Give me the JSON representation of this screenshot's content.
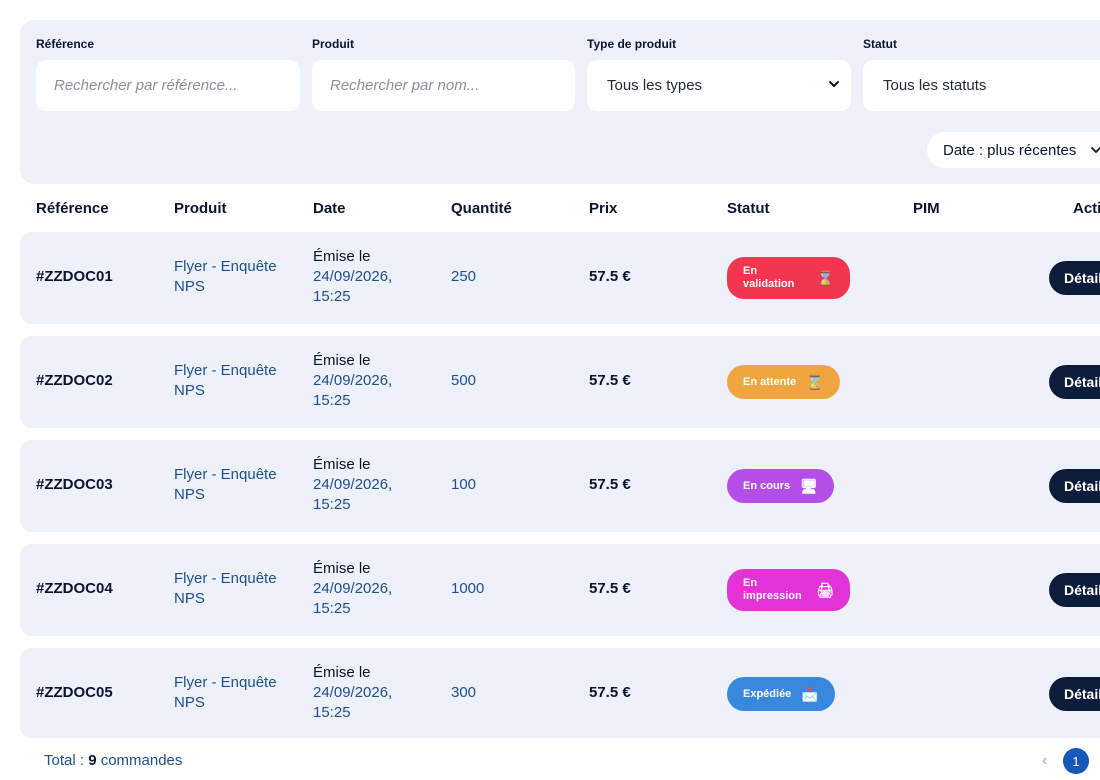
{
  "filters": {
    "reference": {
      "label": "Référence",
      "placeholder": "Rechercher par référence..."
    },
    "product": {
      "label": "Produit",
      "placeholder": "Rechercher par nom..."
    },
    "type": {
      "label": "Type de produit",
      "value": "Tous les types"
    },
    "status": {
      "label": "Statut",
      "value": "Tous les statuts"
    },
    "sort": {
      "label": "Date : plus récentes"
    }
  },
  "table": {
    "headers": [
      "Référence",
      "Produit",
      "Date",
      "Quantité",
      "Prix",
      "Statut",
      "PIM",
      "Acti"
    ],
    "rows": [
      {
        "ref": "#ZZDOC01",
        "product": "Flyer - Enquête NPS",
        "date_l1": "Émise le",
        "date_l2": "24/09/2026,",
        "date_l3": "15:25",
        "qty": "250",
        "price": "57.5 €",
        "status": "En validation",
        "status_icon": "⌛",
        "status_color": "#f2364f",
        "action": "Détails"
      },
      {
        "ref": "#ZZDOC02",
        "product": "Flyer - Enquête NPS",
        "date_l1": "Émise le",
        "date_l2": "24/09/2026,",
        "date_l3": "15:25",
        "qty": "500",
        "price": "57.5 €",
        "status": "En attente",
        "status_icon": "⌛",
        "status_color": "#efa641",
        "action": "Détails"
      },
      {
        "ref": "#ZZDOC03",
        "product": "Flyer - Enquête NPS",
        "date_l1": "Émise le",
        "date_l2": "24/09/2026,",
        "date_l3": "15:25",
        "qty": "100",
        "price": "57.5 €",
        "status": "En cours",
        "status_icon": "🖥",
        "status_color": "#b54ee6",
        "action": "Détails"
      },
      {
        "ref": "#ZZDOC04",
        "product": "Flyer - Enquête NPS",
        "date_l1": "Émise le",
        "date_l2": "24/09/2026,",
        "date_l3": "15:25",
        "qty": "1000",
        "price": "57.5 €",
        "status": "En impression",
        "status_icon": "🖨",
        "status_color": "#e332d5",
        "action": "Détails"
      },
      {
        "ref": "#ZZDOC05",
        "product": "Flyer - Enquête NPS",
        "date_l1": "Émise le",
        "date_l2": "24/09/2026,",
        "date_l3": "15:25",
        "qty": "300",
        "price": "57.5 €",
        "status": "Expédiée",
        "status_icon": "📩",
        "status_color": "#3a87de",
        "action": "Détails"
      }
    ]
  },
  "footer": {
    "total_prefix": "Total : ",
    "total_count": "9",
    "total_suffix": " commandes",
    "prev": "‹",
    "page": "1"
  }
}
